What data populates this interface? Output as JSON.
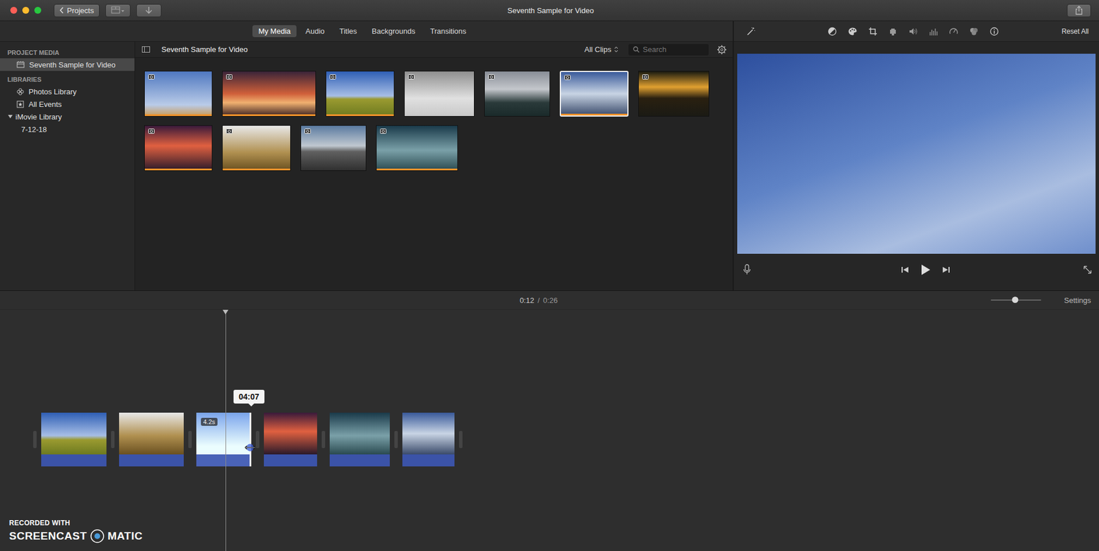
{
  "window": {
    "title": "Seventh Sample for Video"
  },
  "titlebar": {
    "projects_button": "Projects"
  },
  "media_tabs": [
    {
      "label": "My Media",
      "selected": true
    },
    {
      "label": "Audio",
      "selected": false
    },
    {
      "label": "Titles",
      "selected": false
    },
    {
      "label": "Backgrounds",
      "selected": false
    },
    {
      "label": "Transitions",
      "selected": false
    }
  ],
  "viewer_tools": {
    "reset": "Reset All"
  },
  "sidebar": {
    "sections": [
      {
        "heading": "PROJECT MEDIA",
        "items": [
          {
            "label": "Seventh Sample for Video",
            "kind": "project",
            "selected": true
          }
        ]
      },
      {
        "heading": "LIBRARIES",
        "items": [
          {
            "label": "Photos Library",
            "kind": "photos",
            "selected": false
          },
          {
            "label": "All Events",
            "kind": "events",
            "selected": false
          },
          {
            "label": "iMovie Library",
            "kind": "library",
            "selected": false,
            "expanded": true
          },
          {
            "label": "7-12-18",
            "kind": "event",
            "selected": false
          }
        ]
      }
    ]
  },
  "browser": {
    "title": "Seventh Sample for Video",
    "filter": "All Clips",
    "search_placeholder": "Search",
    "clips": [
      {
        "used": true,
        "selected": false
      },
      {
        "used": true,
        "selected": false
      },
      {
        "used": true,
        "selected": false
      },
      {
        "used": false,
        "selected": false
      },
      {
        "used": false,
        "selected": false
      },
      {
        "used": true,
        "selected": true
      },
      {
        "used": false,
        "selected": false
      },
      {
        "used": true,
        "selected": false
      },
      {
        "used": true,
        "selected": false
      },
      {
        "used": false,
        "selected": false
      },
      {
        "used": true,
        "selected": false
      }
    ]
  },
  "timeline": {
    "time": "0:12",
    "separator": "/",
    "duration": "0:26",
    "zoom": {
      "level": 0.48
    },
    "settings": "Settings",
    "tooltip": "04:07",
    "clips": [
      {
        "selected": false
      },
      {
        "selected": false
      },
      {
        "selected": true,
        "badge": "4.2s"
      },
      {
        "selected": false
      },
      {
        "selected": false
      },
      {
        "selected": false
      }
    ]
  },
  "watermark": {
    "line1": "RECORDED WITH",
    "brand_left": "SCREENCAST",
    "brand_right": "MATIC"
  }
}
